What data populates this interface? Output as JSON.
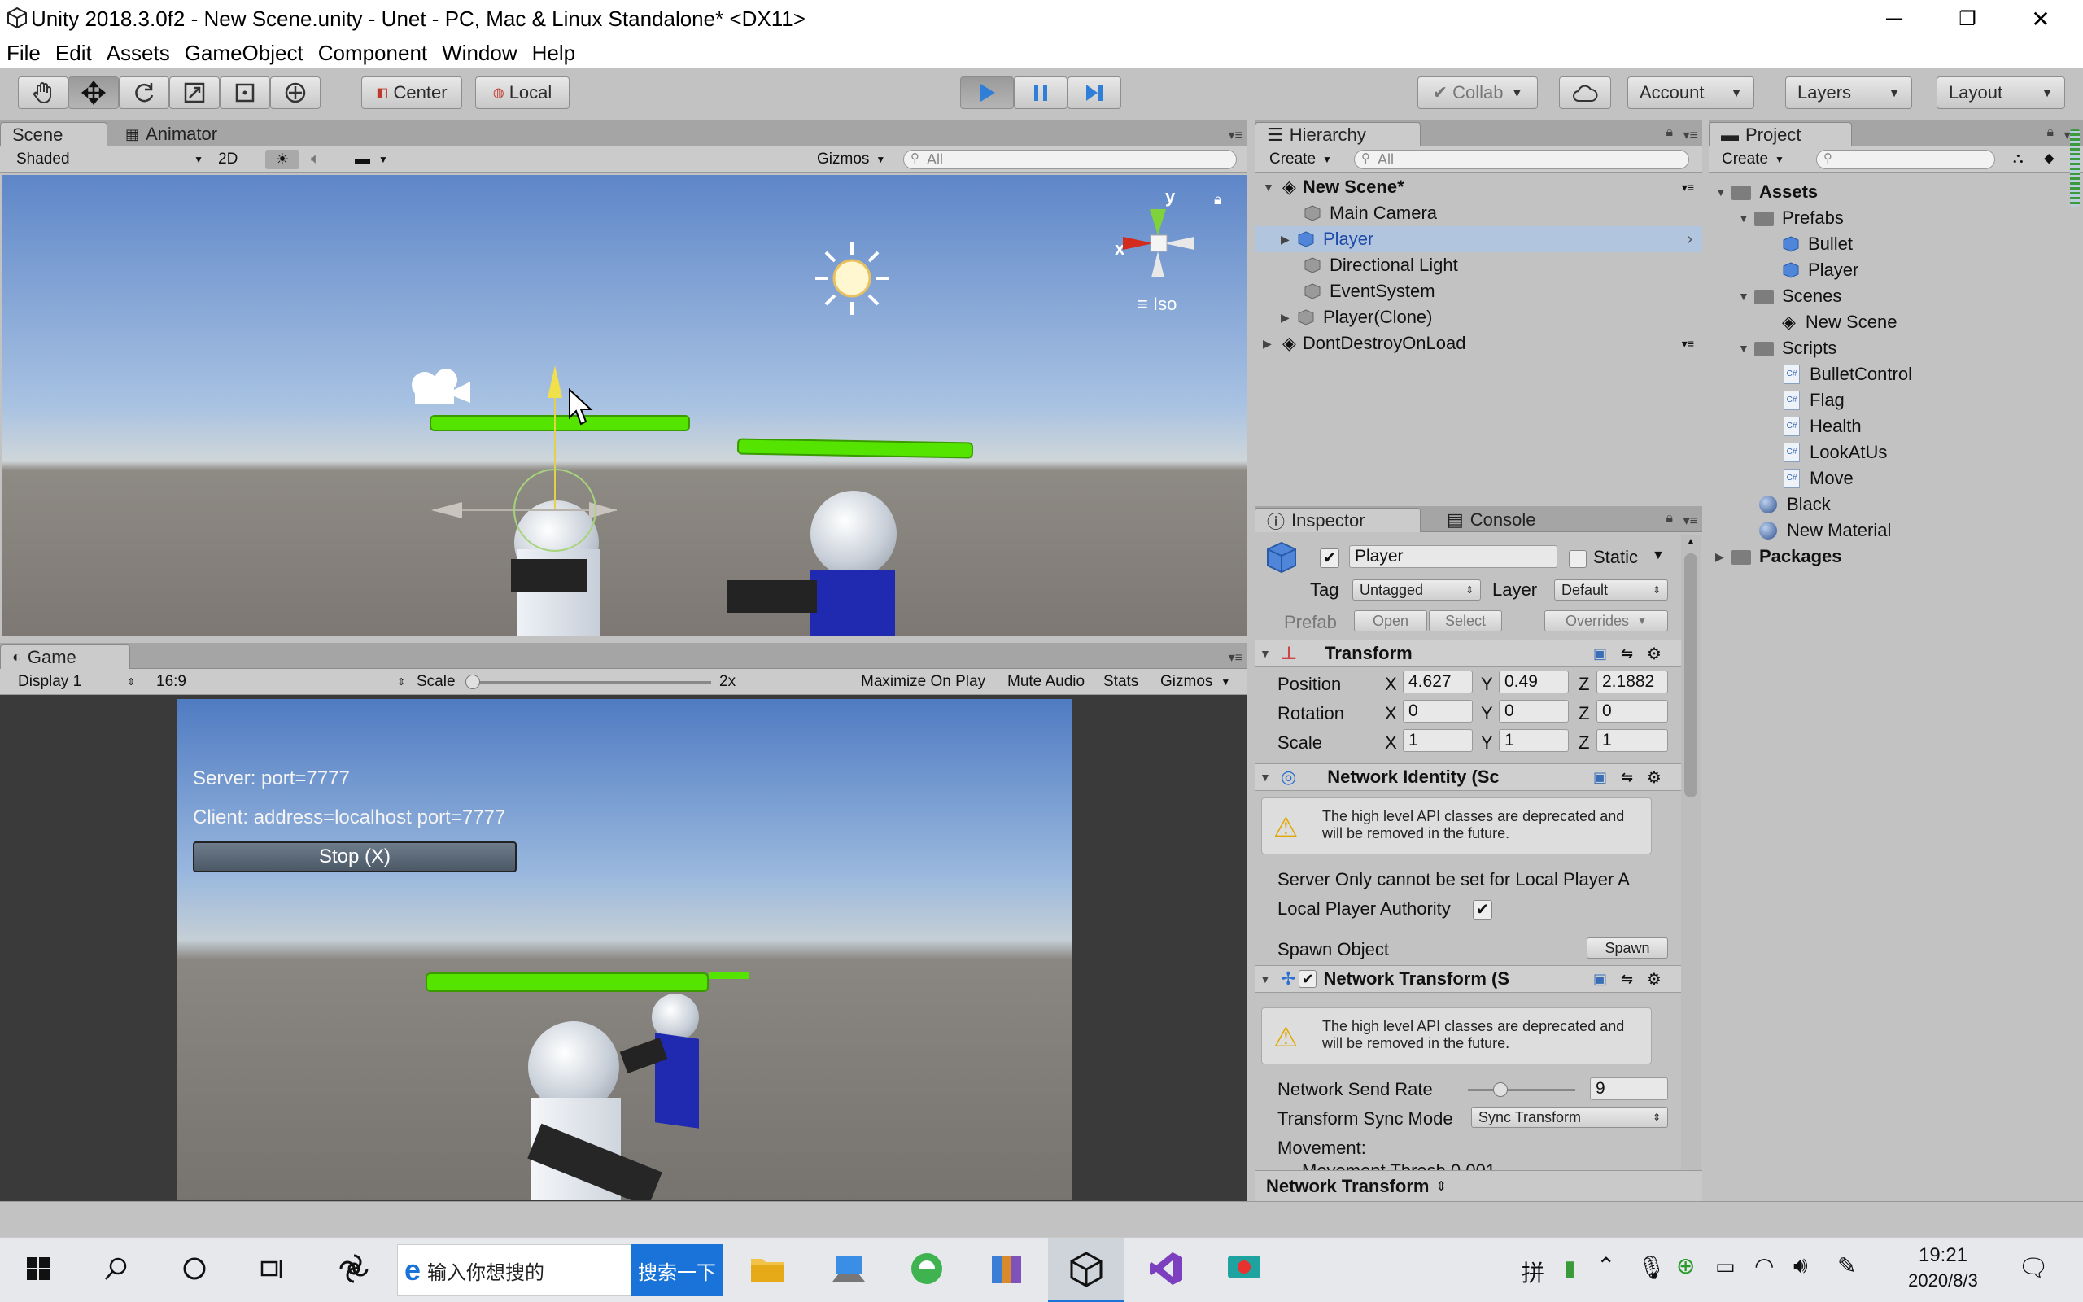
{
  "window": {
    "title": "Unity 2018.3.0f2 - New Scene.unity - Unet - PC, Mac & Linux Standalone* <DX11>",
    "minimize": "─",
    "maximize": "❐",
    "close": "✕"
  },
  "menu": [
    "File",
    "Edit",
    "Assets",
    "GameObject",
    "Component",
    "Window",
    "Help"
  ],
  "toolbar": {
    "pivot": "Center",
    "space": "Local",
    "collab": "Collab",
    "account": "Account",
    "layers": "Layers",
    "layout": "Layout"
  },
  "scene": {
    "tabs": [
      "Scene",
      "Animator"
    ],
    "shading": "Shaded",
    "mode2d": "2D",
    "gizmos": "Gizmos",
    "search_placeholder": "All",
    "axis_y": "y",
    "axis_x": "x",
    "projection": "Iso"
  },
  "game": {
    "tab": "Game",
    "display": "Display 1",
    "aspect": "16:9",
    "scale_label": "Scale",
    "scale_value": "2x",
    "maximize": "Maximize On Play",
    "mute": "Mute Audio",
    "stats": "Stats",
    "gizmos": "Gizmos",
    "server_text": "Server: port=7777",
    "client_text": "Client: address=localhost port=7777",
    "stop_button": "Stop (X)"
  },
  "hierarchy": {
    "tab": "Hierarchy",
    "create": "Create",
    "search_placeholder": "All",
    "scene_name": "New Scene*",
    "items": [
      "Main Camera",
      "Player",
      "Directional Light",
      "EventSystem",
      "Player(Clone)"
    ],
    "dontdestroy": "DontDestroyOnLoad"
  },
  "project": {
    "tab": "Project",
    "create": "Create",
    "tree": {
      "assets": "Assets",
      "prefabs": "Prefabs",
      "prefab_items": [
        "Bullet",
        "Player"
      ],
      "scenes": "Scenes",
      "scene_items": [
        "New Scene"
      ],
      "scripts": "Scripts",
      "script_items": [
        "BulletControl",
        "Flag",
        "Health",
        "LookAtUs",
        "Move"
      ],
      "materials": [
        "Black",
        "New Material"
      ],
      "packages": "Packages"
    },
    "cs_badge": "C#"
  },
  "inspector": {
    "tabs": [
      "Inspector",
      "Console"
    ],
    "object_name": "Player",
    "static_label": "Static",
    "tag_label": "Tag",
    "tag_value": "Untagged",
    "layer_label": "Layer",
    "layer_value": "Default",
    "prefab_label": "Prefab",
    "prefab_open": "Open",
    "prefab_select": "Select",
    "prefab_overrides": "Overrides",
    "transform": {
      "title": "Transform",
      "position_label": "Position",
      "rotation_label": "Rotation",
      "scale_label": "Scale",
      "x": "X",
      "y": "Y",
      "z": "Z",
      "position": [
        "4.627",
        "0.49",
        "2.1882"
      ],
      "rotation": [
        "0",
        "0",
        "0"
      ],
      "scale": [
        "1",
        "1",
        "1"
      ]
    },
    "network_identity": {
      "title": "Network Identity (Sc",
      "warning": "The high level API classes are deprecated and will be removed in the future.",
      "server_only": "Server Only cannot be set for Local Player A",
      "local_player_authority": "Local Player Authority",
      "spawn_label": "Spawn Object",
      "spawn_button": "Spawn"
    },
    "network_transform": {
      "title": "Network Transform (S",
      "warning": "The high level API classes are deprecated and will be removed in the future.",
      "send_rate_label": "Network Send Rate",
      "send_rate_value": "9",
      "send_rate_fraction": 0.3,
      "sync_mode_label": "Transform Sync Mode",
      "sync_mode_value": "Sync Transform",
      "movement_label": "Movement:",
      "movement_threshold_partial": "Movement Thresh  0.001"
    },
    "footer": "Network Transform"
  },
  "taskbar": {
    "search_placeholder": "输入你想搜的",
    "search_button": "搜索一下",
    "ime": "拼",
    "time": "19:21",
    "date": "2020/8/3"
  },
  "colors": {
    "health_green": "#54e400",
    "selection_blue": "#b2c5de",
    "play_blue": "#2f7fd8"
  }
}
